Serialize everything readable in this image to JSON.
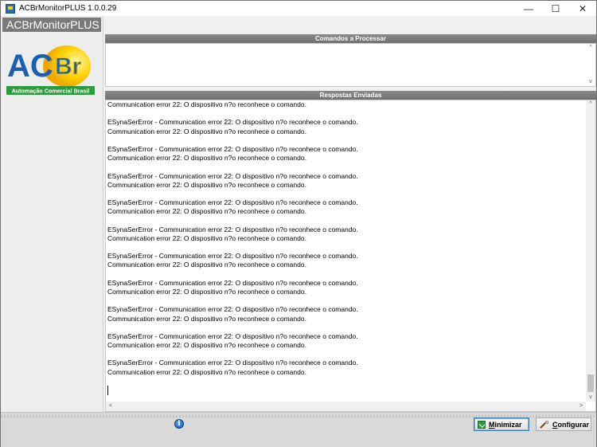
{
  "window": {
    "title": "ACBrMonitorPLUS 1.0.0.29",
    "controls": {
      "minimize": "—",
      "maximize": "☐",
      "close": "✕"
    }
  },
  "left_panel": {
    "brand_header": "ACBrMonitorPLUS",
    "logo": {
      "text_main": "ACBr",
      "tagline": "Automação Comercial Brasil"
    }
  },
  "commands_section": {
    "title": "Comandos a Processar"
  },
  "responses_section": {
    "title": "Respostas Enviadas",
    "lines": [
      "Communication error 22: O dispositivo n?o reconhece o comando.",
      "",
      "ESynaSerError - Communication error 22: O dispositivo n?o reconhece o comando.",
      "Communication error 22: O dispositivo n?o reconhece o comando.",
      "",
      "ESynaSerError - Communication error 22: O dispositivo n?o reconhece o comando.",
      "Communication error 22: O dispositivo n?o reconhece o comando.",
      "",
      "ESynaSerError - Communication error 22: O dispositivo n?o reconhece o comando.",
      "Communication error 22: O dispositivo n?o reconhece o comando.",
      "",
      "ESynaSerError - Communication error 22: O dispositivo n?o reconhece o comando.",
      "Communication error 22: O dispositivo n?o reconhece o comando.",
      "",
      "ESynaSerError - Communication error 22: O dispositivo n?o reconhece o comando.",
      "Communication error 22: O dispositivo n?o reconhece o comando.",
      "",
      "ESynaSerError - Communication error 22: O dispositivo n?o reconhece o comando.",
      "Communication error 22: O dispositivo n?o reconhece o comando.",
      "",
      "ESynaSerError - Communication error 22: O dispositivo n?o reconhece o comando.",
      "Communication error 22: O dispositivo n?o reconhece o comando.",
      "",
      "ESynaSerError - Communication error 22: O dispositivo n?o reconhece o comando.",
      "Communication error 22: O dispositivo n?o reconhece o comando.",
      "",
      "ESynaSerError - Communication error 22: O dispositivo n?o reconhece o comando.",
      "Communication error 22: O dispositivo n?o reconhece o comando.",
      "",
      "ESynaSerError - Communication error 22: O dispositivo n?o reconhece o comando.",
      "Communication error 22: O dispositivo n?o reconhece o comando."
    ]
  },
  "bottom_bar": {
    "info_icon_glyph": "i",
    "minimize_button": {
      "first": "M",
      "rest": "inimizar"
    },
    "configure_button": {
      "first": "C",
      "rest": "onfigurar"
    }
  },
  "colors": {
    "header_gray": "#7a7a7a",
    "logo_blue": "#1a5fb0",
    "logo_yellow": "#f5c400",
    "logo_green": "#2e9a3e"
  }
}
